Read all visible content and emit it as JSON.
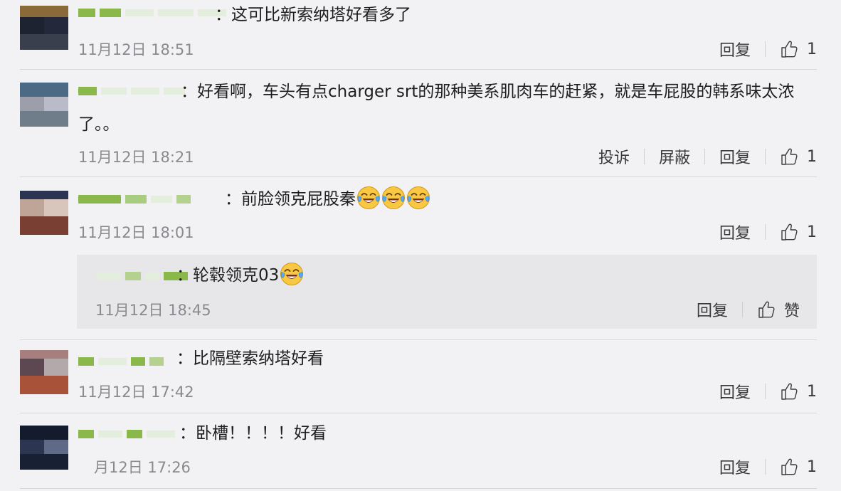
{
  "colors": {
    "background": "#f2f2f5",
    "reply_box": "#e7e7ea",
    "username_green": "#8ab84a",
    "timestamp": "#8a8a8e"
  },
  "comments": [
    {
      "text": "：这可比新索纳塔好看多了",
      "time": "11月12日 18:51",
      "actions": {
        "reply": "回复",
        "like_count": "1"
      }
    },
    {
      "text": "：好看啊，车头有点charger srt的那种美系肌肉车的赶紧，就是车屁股的韩系味太浓了。。",
      "time": "11月12日 18:21",
      "actions": {
        "report": "投诉",
        "block": "屏蔽",
        "reply": "回复",
        "like_count": "1"
      }
    },
    {
      "text": "：前脸领克屁股秦",
      "time": "11月12日 18:01",
      "actions": {
        "reply": "回复",
        "like_count": "1"
      },
      "reply": {
        "text": "：轮毂领克03",
        "time": "11月12日 18:45",
        "actions": {
          "reply": "回复",
          "like": "赞"
        }
      }
    },
    {
      "text": "：比隔壁索纳塔好看",
      "time": "11月12日 17:42",
      "actions": {
        "reply": "回复",
        "like_count": "1"
      }
    },
    {
      "text": "：卧槽！！！！好看",
      "time": "月12日 17:26",
      "actions": {
        "reply": "回复",
        "like_count": "1"
      }
    }
  ]
}
